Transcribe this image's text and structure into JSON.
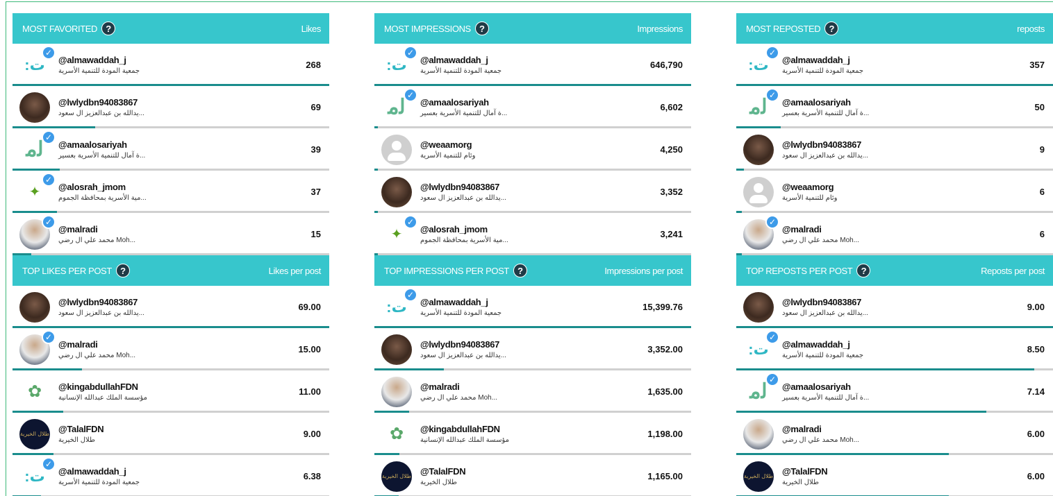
{
  "panels": [
    {
      "title": "MOST FAVORITED",
      "column": "Likes",
      "rows": [
        {
          "handle": "@almawaddah_j",
          "display": "جمعية المودة للتنمية الأسرية",
          "value": "268",
          "avatar": "logo-mw",
          "verified": true,
          "fill": 1.0
        },
        {
          "handle": "@lwlydbn94083867",
          "display": "...يدالله بن عبدالعزيز ال سعود",
          "value": "69",
          "avatar": "photo",
          "verified": false,
          "fill": 0.26
        },
        {
          "handle": "@amaalosariyah",
          "display": "...ة آمال للتنمية الأسرية بعسير",
          "value": "39",
          "avatar": "logo-amaal",
          "verified": true,
          "fill": 0.15
        },
        {
          "handle": "@alosrah_jmom",
          "display": "...مية الأسرية بمحافظة الجموم",
          "value": "37",
          "avatar": "logo-osrah",
          "verified": true,
          "fill": 0.14
        },
        {
          "handle": "@malradi",
          "display": "...Moh محمد علي ال رضي",
          "value": "15",
          "avatar": "photo2",
          "verified": true,
          "fill": 0.06
        }
      ]
    },
    {
      "title": "MOST IMPRESSIONS",
      "column": "Impressions",
      "rows": [
        {
          "handle": "@almawaddah_j",
          "display": "جمعية المودة للتنمية الأسرية",
          "value": "646,790",
          "avatar": "logo-mw",
          "verified": true,
          "fill": 1.0
        },
        {
          "handle": "@amaalosariyah",
          "display": "...ة آمال للتنمية الأسرية بعسير",
          "value": "6,602",
          "avatar": "logo-amaal",
          "verified": true,
          "fill": 0.01
        },
        {
          "handle": "@weaamorg",
          "display": "وئام للتنمية الأسرية",
          "value": "4,250",
          "avatar": "grey",
          "verified": false,
          "fill": 0.007
        },
        {
          "handle": "@lwlydbn94083867",
          "display": "...يدالله بن عبدالعزيز ال سعود",
          "value": "3,352",
          "avatar": "photo",
          "verified": false,
          "fill": 0.005
        },
        {
          "handle": "@alosrah_jmom",
          "display": "...مية الأسرية بمحافظة الجموم",
          "value": "3,241",
          "avatar": "logo-osrah",
          "verified": true,
          "fill": 0.005
        }
      ]
    },
    {
      "title": "MOST REPOSTED",
      "column": "reposts",
      "rows": [
        {
          "handle": "@almawaddah_j",
          "display": "جمعية المودة للتنمية الأسرية",
          "value": "357",
          "avatar": "logo-mw",
          "verified": true,
          "fill": 1.0
        },
        {
          "handle": "@amaalosariyah",
          "display": "...ة آمال للتنمية الأسرية بعسير",
          "value": "50",
          "avatar": "logo-amaal",
          "verified": true,
          "fill": 0.14
        },
        {
          "handle": "@lwlydbn94083867",
          "display": "...يدالله بن عبدالعزيز ال سعود",
          "value": "9",
          "avatar": "photo",
          "verified": false,
          "fill": 0.025
        },
        {
          "handle": "@weaamorg",
          "display": "وئام للتنمية الأسرية",
          "value": "6",
          "avatar": "grey",
          "verified": false,
          "fill": 0.017
        },
        {
          "handle": "@malradi",
          "display": "...Moh محمد علي ال رضي",
          "value": "6",
          "avatar": "photo2",
          "verified": true,
          "fill": 0.017
        }
      ]
    },
    {
      "title": "TOP LIKES PER POST",
      "column": "Likes per post",
      "rows": [
        {
          "handle": "@lwlydbn94083867",
          "display": "...يدالله بن عبدالعزيز ال سعود",
          "value": "69.00",
          "avatar": "photo",
          "verified": false,
          "fill": 1.0
        },
        {
          "handle": "@malradi",
          "display": "...Moh محمد علي ال رضي",
          "value": "15.00",
          "avatar": "photo2",
          "verified": true,
          "fill": 0.22
        },
        {
          "handle": "@kingabdullahFDN",
          "display": "مؤسسة الملك عبدالله الإنسانية",
          "value": "11.00",
          "avatar": "logo-kaf",
          "verified": false,
          "fill": 0.16
        },
        {
          "handle": "@TalalFDN",
          "display": "طلال الخيرية",
          "value": "9.00",
          "avatar": "dark",
          "verified": false,
          "fill": 0.13
        },
        {
          "handle": "@almawaddah_j",
          "display": "جمعية المودة للتنمية الأسرية",
          "value": "6.38",
          "avatar": "logo-mw",
          "verified": true,
          "fill": 0.09
        }
      ]
    },
    {
      "title": "TOP IMPRESSIONS PER POST",
      "column": "Impressions per post",
      "rows": [
        {
          "handle": "@almawaddah_j",
          "display": "جمعية المودة للتنمية الأسرية",
          "value": "15,399.76",
          "avatar": "logo-mw",
          "verified": true,
          "fill": 1.0
        },
        {
          "handle": "@lwlydbn94083867",
          "display": "...يدالله بن عبدالعزيز ال سعود",
          "value": "3,352.00",
          "avatar": "photo",
          "verified": false,
          "fill": 0.22
        },
        {
          "handle": "@malradi",
          "display": "...Moh محمد علي ال رضي",
          "value": "1,635.00",
          "avatar": "photo2",
          "verified": false,
          "fill": 0.11
        },
        {
          "handle": "@kingabdullahFDN",
          "display": "مؤسسة الملك عبدالله الإنسانية",
          "value": "1,198.00",
          "avatar": "logo-kaf",
          "verified": false,
          "fill": 0.08
        },
        {
          "handle": "@TalalFDN",
          "display": "طلال الخيرية",
          "value": "1,165.00",
          "avatar": "dark",
          "verified": false,
          "fill": 0.076
        }
      ]
    },
    {
      "title": "TOP REPOSTS PER POST",
      "column": "Reposts per post",
      "rows": [
        {
          "handle": "@lwlydbn94083867",
          "display": "...يدالله بن عبدالعزيز ال سعود",
          "value": "9.00",
          "avatar": "photo",
          "verified": false,
          "fill": 1.0
        },
        {
          "handle": "@almawaddah_j",
          "display": "جمعية المودة للتنمية الأسرية",
          "value": "8.50",
          "avatar": "logo-mw",
          "verified": true,
          "fill": 0.94
        },
        {
          "handle": "@amaalosariyah",
          "display": "...ة آمال للتنمية الأسرية بعسير",
          "value": "7.14",
          "avatar": "logo-amaal",
          "verified": true,
          "fill": 0.79
        },
        {
          "handle": "@malradi",
          "display": "...Moh محمد علي ال رضي",
          "value": "6.00",
          "avatar": "photo2",
          "verified": false,
          "fill": 0.67
        },
        {
          "handle": "@TalalFDN",
          "display": "طلال الخيرية",
          "value": "6.00",
          "avatar": "dark",
          "verified": false,
          "fill": 0.67
        }
      ]
    }
  ],
  "icons": {
    "help": "?",
    "verified": "✓",
    "talal_logo_text": "طلال الخيرية"
  },
  "colors": {
    "header": "#37c6cc",
    "bar_fill": "#1a8d8d",
    "bar_bg": "#d0d0d0",
    "verified": "#3d9be9"
  }
}
